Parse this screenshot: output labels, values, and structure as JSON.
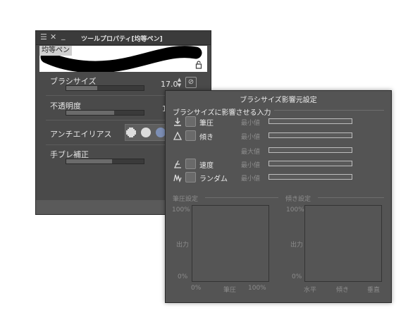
{
  "tool_panel": {
    "title": "ツールプロパティ[均等ペン]",
    "preview_label": "均等ペン",
    "brush_size": {
      "label": "ブラシサイズ",
      "value": "17.0",
      "level": 0.4
    },
    "opacity": {
      "label": "不透明度",
      "value_partial": "1",
      "level": 0.62
    },
    "antialias": {
      "label": "アンチエイリアス"
    },
    "stabilization": {
      "label": "手ブレ補正",
      "level": 0.59
    }
  },
  "dialog": {
    "title": "ブラシサイズ影響元設定",
    "section": "ブラシサイズに影響させる入力",
    "inputs": [
      {
        "name": "pen-pressure",
        "icon": "pen-pressure-icon",
        "label": "筆圧",
        "range_label": "最小値"
      },
      {
        "name": "tilt",
        "icon": "tilt-icon",
        "label": "傾き",
        "range_label": "最小値"
      },
      {
        "name": "tilt-max",
        "icon": "",
        "label": "",
        "range_label": "最大値"
      },
      {
        "name": "speed",
        "icon": "speed-icon",
        "label": "速度",
        "range_label": "最小値"
      },
      {
        "name": "random",
        "icon": "random-icon",
        "label": "ランダム",
        "range_label": "最小値"
      }
    ],
    "pressure_graph": {
      "heading": "筆圧設定",
      "y_top": "100%",
      "y_mid": "出力",
      "y_bottom": "0%",
      "x_left": "0%",
      "x_mid": "筆圧",
      "x_right": "100%"
    },
    "tilt_graph": {
      "heading": "傾き設定",
      "y_top": "100%",
      "y_mid": "出力",
      "y_bottom": "0%",
      "x_left": "水平",
      "x_mid": "傾き",
      "x_right": "垂直"
    }
  }
}
